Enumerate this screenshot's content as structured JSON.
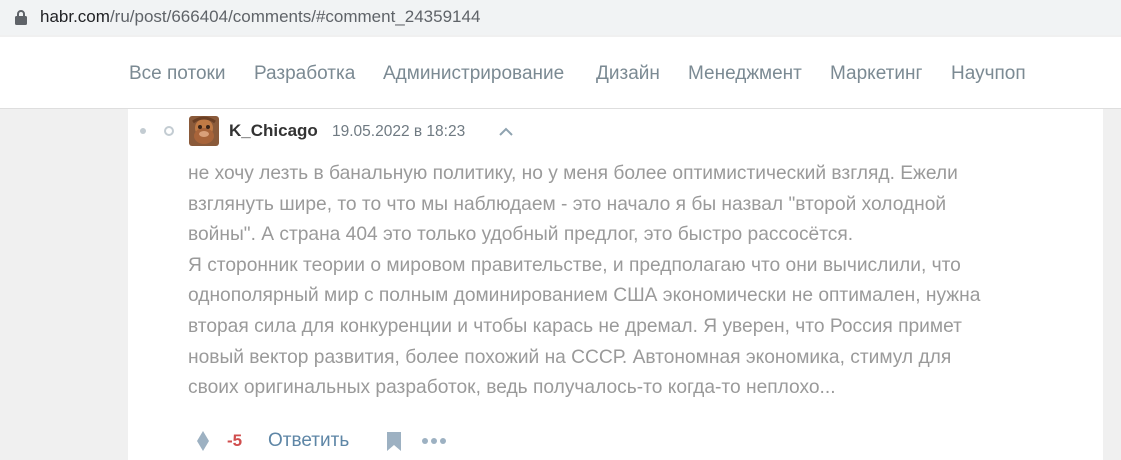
{
  "browser": {
    "url_host": "habr.com",
    "url_path": "/ru/post/666404/comments/#comment_24359144"
  },
  "nav": {
    "items": [
      {
        "label": "Все потоки"
      },
      {
        "label": "Разработка"
      },
      {
        "label": "Администрирование"
      },
      {
        "label": "Дизайн"
      },
      {
        "label": "Менеджмент"
      },
      {
        "label": "Маркетинг"
      },
      {
        "label": "Научпоп"
      }
    ]
  },
  "comment": {
    "author": "K_Chicago",
    "date": "19.05.2022 в 18:23",
    "body_lines": [
      "не хочу лезть в банальную политику, но у меня более оптимистический взгляд. Ежели",
      "взглянуть шире, то то что мы наблюдаем - это начало я бы назвал \"второй холодной",
      "войны\". А страна 404 это только удобный предлог, это быстро рассосётся.",
      "Я сторонник теории о мировом правительстве, и предполагаю что они вычислили, что",
      "однополярный мир с полным доминированием США экономически не оптимален, нужна",
      "вторая сила для конкуренции и чтобы карась не дремал. Я уверен, что Россия примет",
      "новый вектор развития, более похожий на СССР. Автономная экономика, стимул для",
      "своих оригинальных разработок, ведь получалось-то когда-то неплохо..."
    ],
    "score": "-5",
    "reply_label": "Ответить"
  },
  "colors": {
    "nav_text": "#7b8a93",
    "comment_text": "#9a9a9a",
    "negative_score": "#d04e4e",
    "link": "#5e86a6"
  },
  "icons": {
    "lock": "lock-icon",
    "collapse": "chevron-up-icon",
    "vote": "vote-icon",
    "bookmark": "bookmark-icon",
    "more": "more-icon"
  }
}
